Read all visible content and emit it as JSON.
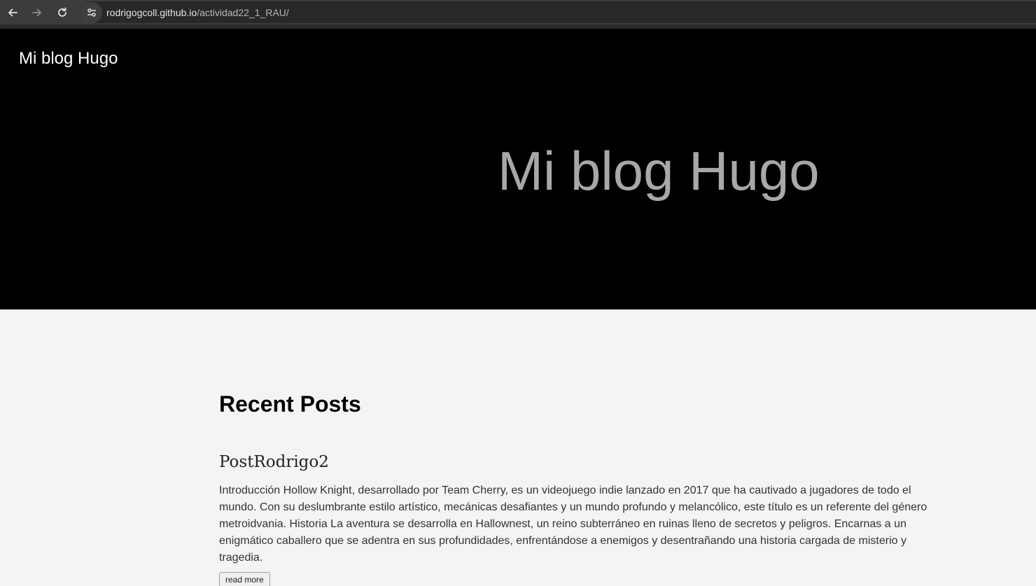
{
  "browser": {
    "url_host": "rodrigogcoll.github.io",
    "url_path": "/actividad22_1_RAU/"
  },
  "header": {
    "site_title": "Mi blog Hugo",
    "hero_title": "Mi blog Hugo"
  },
  "main": {
    "section_heading": "Recent Posts",
    "posts": [
      {
        "title": "PostRodrigo2",
        "summary": "Introducción Hollow Knight, desarrollado por Team Cherry, es un videojuego indie lanzado en 2017 que ha cautivado a jugadores de todo el mundo. Con su deslumbrante estilo artístico, mecánicas desafiantes y un mundo profundo y melancólico, este título es un referente del género metroidvania. Historia La aventura se desarrolla en Hallownest, un reino subterráneo en ruinas lleno de secretos y peligros. Encarnas a un enigmático caballero que se adentra en sus profundidades, enfrentándose a enemigos y desentrañando una historia cargada de misterio y tragedia.",
        "read_more_label": "read more"
      }
    ]
  }
}
